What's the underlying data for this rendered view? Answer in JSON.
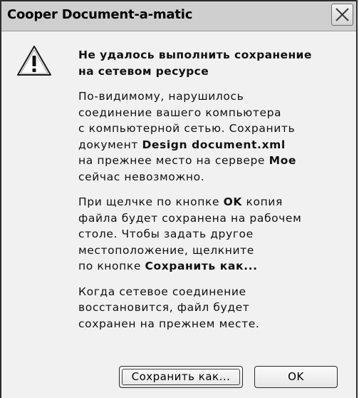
{
  "window": {
    "title": "Cooper Document-a-matic"
  },
  "icons": {
    "title_close": "close-icon",
    "message": "warning-icon"
  },
  "message": {
    "heading_lines": [
      "Не удалось выполнить сохранение",
      "на сетевом ресурсе"
    ],
    "p1": {
      "line1": "По-видимому, нарушилось",
      "line2": "соединение вашего компьютера",
      "line3": "с компьютерной сетью. Сохранить",
      "line4_prefix": "документ ",
      "line4_bold": "Design document.xml",
      "line5_prefix": "на прежнее место на сервере ",
      "line5_bold": "Мое",
      "line6": "сейчас невозможно."
    },
    "p2": {
      "line1_prefix": "При щелчке по кнопке ",
      "line1_bold": "OK",
      "line1_suffix": " копия",
      "line2": "файла будет сохранена на рабочем",
      "line3": "столе. Чтобы задать другое",
      "line4": "местоположение, щелкните",
      "line5_prefix": "по кнопке ",
      "line5_bold": "Сохранить как..."
    },
    "p3": {
      "line1": "Когда сетевое соединение",
      "line2": "восстановится, файл будет",
      "line3": "сохранен на прежнем месте."
    }
  },
  "buttons": {
    "save_as": "Сохранить как...",
    "ok": "OK"
  },
  "colors": {
    "titlebar": "#cfcfcf",
    "dialog_bg": "#f1f1f1",
    "border": "#2c2c2c"
  }
}
